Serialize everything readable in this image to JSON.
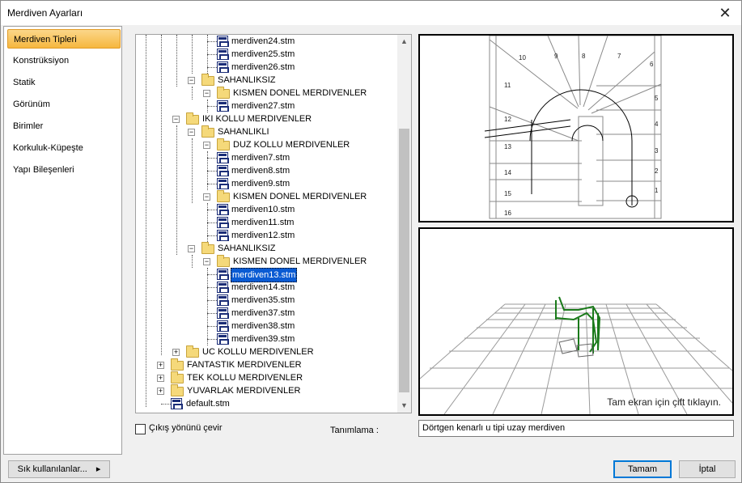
{
  "window": {
    "title": "Merdiven Ayarları",
    "close_glyph": "✕"
  },
  "sidebar": {
    "items": [
      {
        "label": "Merdiven Tipleri",
        "active": true
      },
      {
        "label": "Konstrüksiyon"
      },
      {
        "label": "Statik"
      },
      {
        "label": "Görünüm"
      },
      {
        "label": "Birimler"
      },
      {
        "label": "Korkuluk-Küpeşte"
      },
      {
        "label": "Yapı Bileşenleri"
      }
    ]
  },
  "tree": {
    "nodes": [
      {
        "label": "merdiven24.stm",
        "type": "file"
      },
      {
        "label": "merdiven25.stm",
        "type": "file"
      },
      {
        "label": "merdiven26.stm",
        "type": "file"
      },
      {
        "label": "SAHANLIKSIZ",
        "type": "folder",
        "expander": "−"
      },
      {
        "label": "KISMEN DONEL MERDIVENLER",
        "type": "folder",
        "expander": "−"
      },
      {
        "label": "merdiven27.stm",
        "type": "file"
      },
      {
        "label": "IKI KOLLU MERDIVENLER",
        "type": "folder",
        "expander": "−"
      },
      {
        "label": "SAHANLIKLI",
        "type": "folder",
        "expander": "−"
      },
      {
        "label": "DUZ KOLLU MERDIVENLER",
        "type": "folder",
        "expander": "−"
      },
      {
        "label": "merdiven7.stm",
        "type": "file"
      },
      {
        "label": "merdiven8.stm",
        "type": "file"
      },
      {
        "label": "merdiven9.stm",
        "type": "file"
      },
      {
        "label": "KISMEN DONEL MERDIVENLER",
        "type": "folder",
        "expander": "−"
      },
      {
        "label": "merdiven10.stm",
        "type": "file"
      },
      {
        "label": "merdiven11.stm",
        "type": "file"
      },
      {
        "label": "merdiven12.stm",
        "type": "file"
      },
      {
        "label": "SAHANLIKSIZ",
        "type": "folder",
        "expander": "−"
      },
      {
        "label": "KISMEN DONEL MERDIVENLER",
        "type": "folder",
        "expander": "−"
      },
      {
        "label": "merdiven13.stm",
        "type": "file",
        "selected": true
      },
      {
        "label": "merdiven14.stm",
        "type": "file"
      },
      {
        "label": "merdiven35.stm",
        "type": "file"
      },
      {
        "label": "merdiven37.stm",
        "type": "file"
      },
      {
        "label": "merdiven38.stm",
        "type": "file"
      },
      {
        "label": "merdiven39.stm",
        "type": "file"
      },
      {
        "label": "UC KOLLU MERDIVENLER",
        "type": "folder",
        "expander": "+"
      },
      {
        "label": "FANTASTIK MERDIVENLER",
        "type": "folder",
        "expander": "+"
      },
      {
        "label": "TEK KOLLU MERDIVENLER",
        "type": "folder",
        "expander": "+"
      },
      {
        "label": "YUVARLAK MERDIVENLER",
        "type": "folder",
        "expander": "+"
      },
      {
        "label": "default.stm",
        "type": "file"
      }
    ],
    "scroll_up": "▲",
    "scroll_down": "▼"
  },
  "plan_preview": {
    "step_numbers": [
      "10",
      "9",
      "8",
      "7",
      "6",
      "5",
      "4",
      "3",
      "2",
      "1",
      "11",
      "12",
      "13",
      "14",
      "15",
      "16"
    ]
  },
  "view3d": {
    "hint": "Tam ekran için çift tıklayın."
  },
  "checkbox": {
    "label": "Çıkış yönünü çevir",
    "checked": false
  },
  "description": {
    "label": "Tanımlama :",
    "value": "Dörtgen kenarlı u tipi uzay merdiven"
  },
  "buttons": {
    "favorites": "Sık kullanılanlar...",
    "favorites_arrow": "▸",
    "ok": "Tamam",
    "cancel": "İptal"
  },
  "colors": {
    "accent_selected": "#0a5bd3",
    "active_tab": "#f6b73f",
    "stair_green": "#1a7a1a"
  }
}
